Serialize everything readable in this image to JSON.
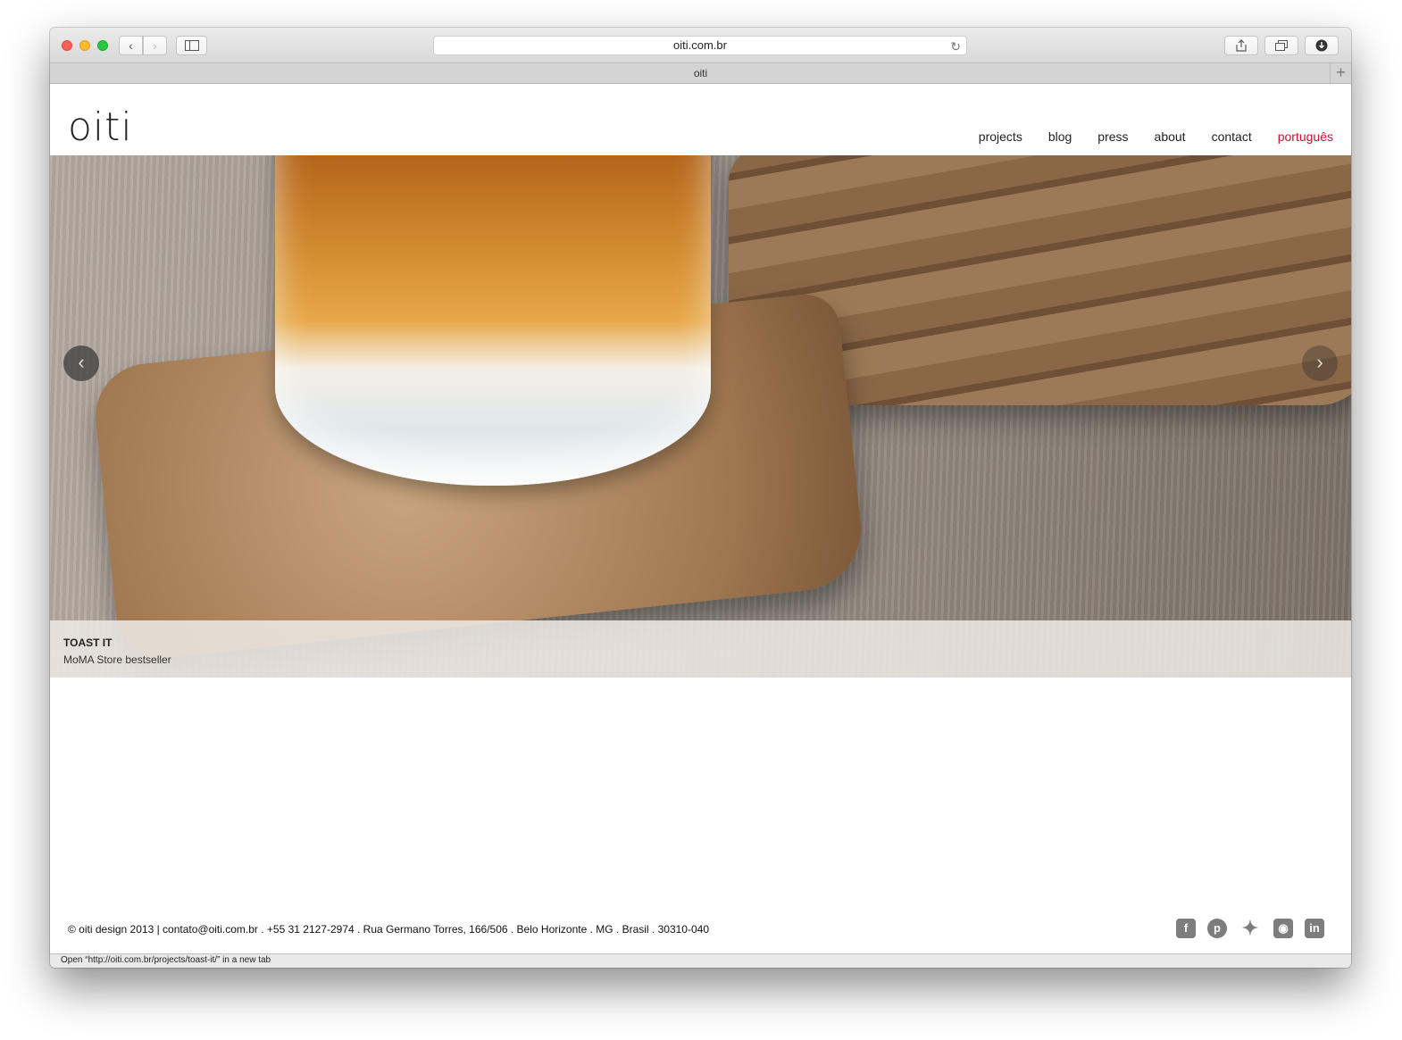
{
  "browser": {
    "url": "oiti.com.br",
    "tab_title": "oiti",
    "status_text": "Open “http://oiti.com.br/projects/toast-it/” in a new tab",
    "icons": [
      "back-icon",
      "forward-icon",
      "sidebar-icon",
      "reload-icon",
      "share-icon",
      "tabs-icon",
      "download-icon",
      "new-tab-icon"
    ]
  },
  "site": {
    "logo": "oiti",
    "nav": [
      "projects",
      "blog",
      "press",
      "about",
      "contact",
      "português"
    ],
    "accent_color": "#c8102e"
  },
  "slider": {
    "caption_title": "TOAST IT",
    "caption_subtitle": "MoMA Store bestseller",
    "prev_arrow": "‹",
    "next_arrow": "›"
  },
  "footer": {
    "text": "© oiti design 2013 | contato@oiti.com.br . +55 31 2127-2974 . Rua Germano Torres, 166/506 . Belo Horizonte . MG . Brasil . 30310-040",
    "social": [
      "facebook-icon",
      "pinterest-icon",
      "twitter-icon",
      "instagram-icon",
      "linkedin-icon"
    ]
  }
}
